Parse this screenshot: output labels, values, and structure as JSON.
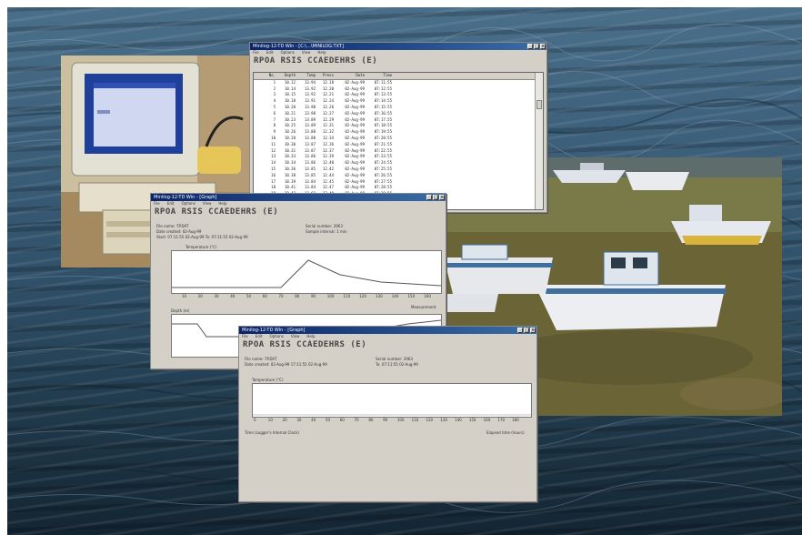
{
  "colors": {
    "sea": "#3a5d78",
    "titlebar": "#0a246a",
    "window_face": "#d4d0c8",
    "grass": "#6e6e3a",
    "boat_hull": "#e9e9ec",
    "boat_stripe": "#3e6f9e"
  },
  "windows": {
    "log_table": {
      "title": "Minilog-12-TD Win - [C:\\...\\MINILOG.TXT]",
      "menus": [
        "File",
        "Edit",
        "Options",
        "View",
        "Help"
      ],
      "heading": "RPOA RSIS CCAEDEHRS (E)",
      "columns": [
        "No.",
        "Depth",
        "Temp",
        "Press",
        "Date",
        "Time"
      ],
      "rows": [
        [
          "1",
          "10.12",
          "13.94",
          "12.18",
          "02-Aug-99",
          "07:11:55"
        ],
        [
          "2",
          "10.14",
          "13.92",
          "12.20",
          "02-Aug-99",
          "07:12:55"
        ],
        [
          "3",
          "10.15",
          "13.92",
          "12.21",
          "02-Aug-99",
          "07:13:55"
        ],
        [
          "4",
          "10.18",
          "13.91",
          "12.24",
          "02-Aug-99",
          "07:14:55"
        ],
        [
          "5",
          "10.20",
          "13.90",
          "12.26",
          "02-Aug-99",
          "07:15:55"
        ],
        [
          "6",
          "10.21",
          "13.90",
          "12.27",
          "02-Aug-99",
          "07:16:55"
        ],
        [
          "7",
          "10.23",
          "13.89",
          "12.29",
          "02-Aug-99",
          "07:17:55"
        ],
        [
          "8",
          "10.25",
          "13.89",
          "12.31",
          "02-Aug-99",
          "07:18:55"
        ],
        [
          "9",
          "10.26",
          "13.88",
          "12.32",
          "02-Aug-99",
          "07:19:55"
        ],
        [
          "10",
          "10.28",
          "13.88",
          "12.34",
          "02-Aug-99",
          "07:20:55"
        ],
        [
          "11",
          "10.30",
          "13.87",
          "12.36",
          "02-Aug-99",
          "07:21:55"
        ],
        [
          "12",
          "10.31",
          "13.87",
          "12.37",
          "02-Aug-99",
          "07:22:55"
        ],
        [
          "13",
          "10.33",
          "13.86",
          "12.39",
          "02-Aug-99",
          "07:23:55"
        ],
        [
          "14",
          "10.34",
          "13.86",
          "12.40",
          "02-Aug-99",
          "07:24:55"
        ],
        [
          "15",
          "10.36",
          "13.85",
          "12.42",
          "02-Aug-99",
          "07:25:55"
        ],
        [
          "16",
          "10.38",
          "13.85",
          "12.44",
          "02-Aug-99",
          "07:26:55"
        ],
        [
          "17",
          "10.39",
          "13.84",
          "12.45",
          "02-Aug-99",
          "07:27:55"
        ],
        [
          "18",
          "10.41",
          "13.84",
          "12.47",
          "02-Aug-99",
          "07:28:55"
        ],
        [
          "19",
          "10.43",
          "13.83",
          "12.49",
          "02-Aug-99",
          "07:29:55"
        ],
        [
          "20",
          "10.44",
          "13.83",
          "12.50",
          "02-Aug-99",
          "07:30:55"
        ]
      ]
    },
    "two_graphs": {
      "title": "Minilog-12-TD Win - [Graph]",
      "menus": [
        "File",
        "Edit",
        "Options",
        "View",
        "Help"
      ],
      "heading": "RPOA RSIS CCAEDEHRS (E)",
      "info_left": [
        "File name: 7P.DAT",
        "Date created: 02-Aug-99",
        "Start: 07:11:55    02-Aug-99    To: 07:11:55    02-Aug-99"
      ],
      "info_right": [
        "Serial number: 2963",
        "Sample interval: 1 min"
      ],
      "graph_top_title": "Temperature (°C)",
      "graph_bottom_title": "Depth (m)",
      "x_ticks": [
        "10",
        "20",
        "30",
        "40",
        "50",
        "60",
        "70",
        "80",
        "90",
        "100",
        "110",
        "120",
        "130",
        "140",
        "150",
        "160"
      ],
      "x_axis_label": "Measurement"
    },
    "single_graph": {
      "title": "Minilog-12-TD Win - [Graph]",
      "menus": [
        "File",
        "Edit",
        "Options",
        "View",
        "Help"
      ],
      "heading": "RPOA RSIS CCAEDEHRS (E)",
      "info_left": [
        "File name: 7P.DAT",
        "Date created: 02-Aug-99  17:11:55  02-Aug-99"
      ],
      "info_right": [
        "Serial number: 2963",
        "To: 07:11:55  02-Aug-99"
      ],
      "graph_title": "Temperature (°C)",
      "x_ticks": [
        "0",
        "10",
        "20",
        "30",
        "40",
        "50",
        "60",
        "70",
        "80",
        "90",
        "100",
        "110",
        "120",
        "130",
        "140",
        "150",
        "160",
        "170",
        "180"
      ],
      "footer_left": "Time (Logger's Internal Clock)",
      "footer_right": "Elapsed time (hours)"
    }
  }
}
